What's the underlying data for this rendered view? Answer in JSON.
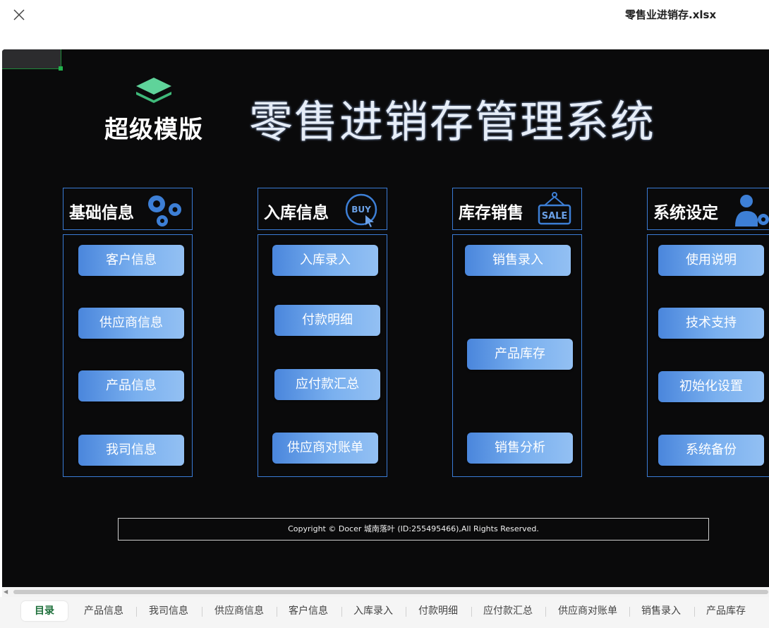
{
  "window": {
    "file_title": "零售业进销存.xlsx",
    "close_icon": "close-icon"
  },
  "sheet": {
    "logo_text": "超级模版",
    "logo_icon": "layers-icon",
    "title": "零售进销存管理系统",
    "accent_color": "#3a7bd5",
    "button_gradient": [
      "#4a86dc",
      "#93c0f3"
    ],
    "columns": [
      {
        "header": "基础信息",
        "icon": "gears-icon",
        "buttons": [
          "客户信息",
          "供应商信息",
          "产品信息",
          "我司信息"
        ]
      },
      {
        "header": "入库信息",
        "icon": "buy-icon",
        "buttons": [
          "入库录入",
          "付款明细",
          "应付款汇总",
          "供应商对账单"
        ]
      },
      {
        "header": "库存销售",
        "icon": "sale-sign-icon",
        "buttons": [
          "销售录入",
          "产品库存",
          "销售分析"
        ]
      },
      {
        "header": "系统设定",
        "icon": "user-settings-icon",
        "buttons": [
          "使用说明",
          "技术支持",
          "初始化设置",
          "系统备份"
        ]
      }
    ],
    "copyright": "Copyright © Docer 城南落叶 (ID:255495466),All Rights Reserved."
  },
  "tabs": {
    "active": "目录",
    "items": [
      "目录",
      "产品信息",
      "我司信息",
      "供应商信息",
      "客户信息",
      "入库录入",
      "付款明细",
      "应付款汇总",
      "供应商对账单",
      "销售录入",
      "产品库存"
    ]
  }
}
